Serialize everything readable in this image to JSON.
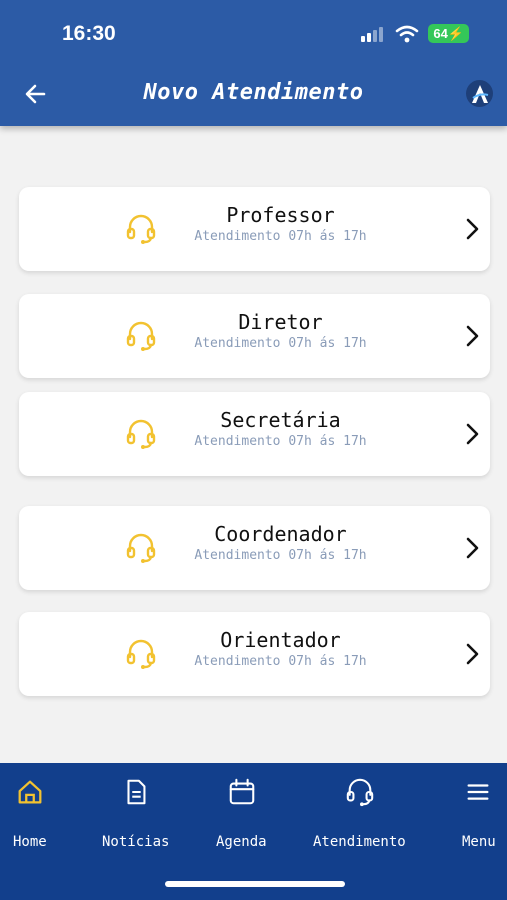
{
  "status_bar": {
    "time": "16:30",
    "battery": "64"
  },
  "header": {
    "title": "Novo Atendimento"
  },
  "colors": {
    "header": "#2c5ba6",
    "nav": "#123f8c",
    "accent": "#f2c230",
    "hours_text": "#8a9cb8"
  },
  "contacts": [
    {
      "name": "Professor",
      "hours": "Atendimento 07h ás 17h",
      "icon": "headset-icon"
    },
    {
      "name": "Diretor",
      "hours": "Atendimento 07h ás 17h",
      "icon": "headset-icon"
    },
    {
      "name": "Secretária",
      "hours": "Atendimento 07h ás 17h",
      "icon": "headset-icon"
    },
    {
      "name": "Coordenador",
      "hours": "Atendimento 07h ás 17h",
      "icon": "headset-icon"
    },
    {
      "name": "Orientador",
      "hours": "Atendimento 07h ás 17h",
      "icon": "headset-icon"
    }
  ],
  "nav": [
    {
      "label": "Home",
      "icon": "home-icon",
      "active": true
    },
    {
      "label": "Notícias",
      "icon": "document-icon"
    },
    {
      "label": "Agenda",
      "icon": "calendar-icon"
    },
    {
      "label": "Atendimento",
      "icon": "headset-icon"
    },
    {
      "label": "Menu",
      "icon": "menu-icon"
    }
  ]
}
